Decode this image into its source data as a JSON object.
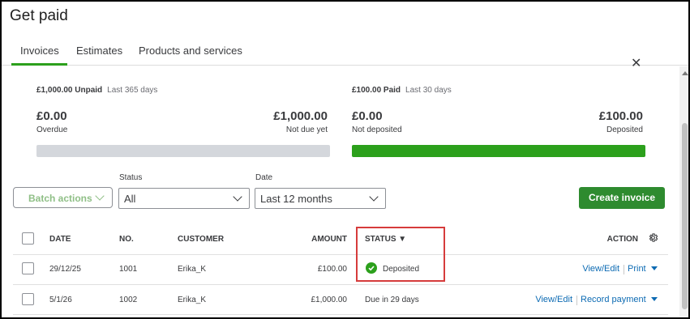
{
  "page_title": "Get paid",
  "tabs": [
    {
      "label": "Invoices",
      "active": true
    },
    {
      "label": "Estimates",
      "active": false
    },
    {
      "label": "Products and services",
      "active": false
    }
  ],
  "summary": {
    "unpaid": {
      "heading": "£1,000.00 Unpaid",
      "period": "Last 365 days",
      "left_amount": "£0.00",
      "left_label": "Overdue",
      "right_amount": "£1,000.00",
      "right_label": "Not due yet",
      "bar_fill_fraction": 0.0,
      "bar_color": "#d4d7dc"
    },
    "paid": {
      "heading": "£100.00 Paid",
      "period": "Last 30 days",
      "left_amount": "£0.00",
      "left_label": "Not deposited",
      "right_amount": "£100.00",
      "right_label": "Deposited",
      "bar_fill_fraction": 1.0,
      "bar_color": "#2ca01c"
    }
  },
  "filters": {
    "batch_actions_label": "Batch actions",
    "status_label": "Status",
    "status_value": "All",
    "date_label": "Date",
    "date_value": "Last 12 months"
  },
  "create_invoice_label": "Create invoice",
  "table": {
    "headers": {
      "date": "DATE",
      "no": "NO.",
      "customer": "CUSTOMER",
      "amount": "AMOUNT",
      "status": "STATUS ▼",
      "action": "ACTION"
    },
    "rows": [
      {
        "date": "29/12/25",
        "no": "1001",
        "customer": "Erika_K",
        "amount": "£100.00",
        "status": "Deposited",
        "action_primary": "View/Edit",
        "action_secondary": "Print"
      },
      {
        "date": "5/1/26",
        "no": "1002",
        "customer": "Erika_K",
        "amount": "£1,000.00",
        "status": "Due in 29 days",
        "action_primary": "View/Edit",
        "action_secondary": "Record payment"
      }
    ]
  },
  "colors": {
    "brand_green": "#2ca01c",
    "button_green": "#2e8b2f",
    "link_blue": "#0d6bb3",
    "highlight_red": "#d63c3c"
  },
  "icons": {
    "close": "close-icon",
    "settings": "gear-icon",
    "status_ok": "check-circle-icon"
  }
}
